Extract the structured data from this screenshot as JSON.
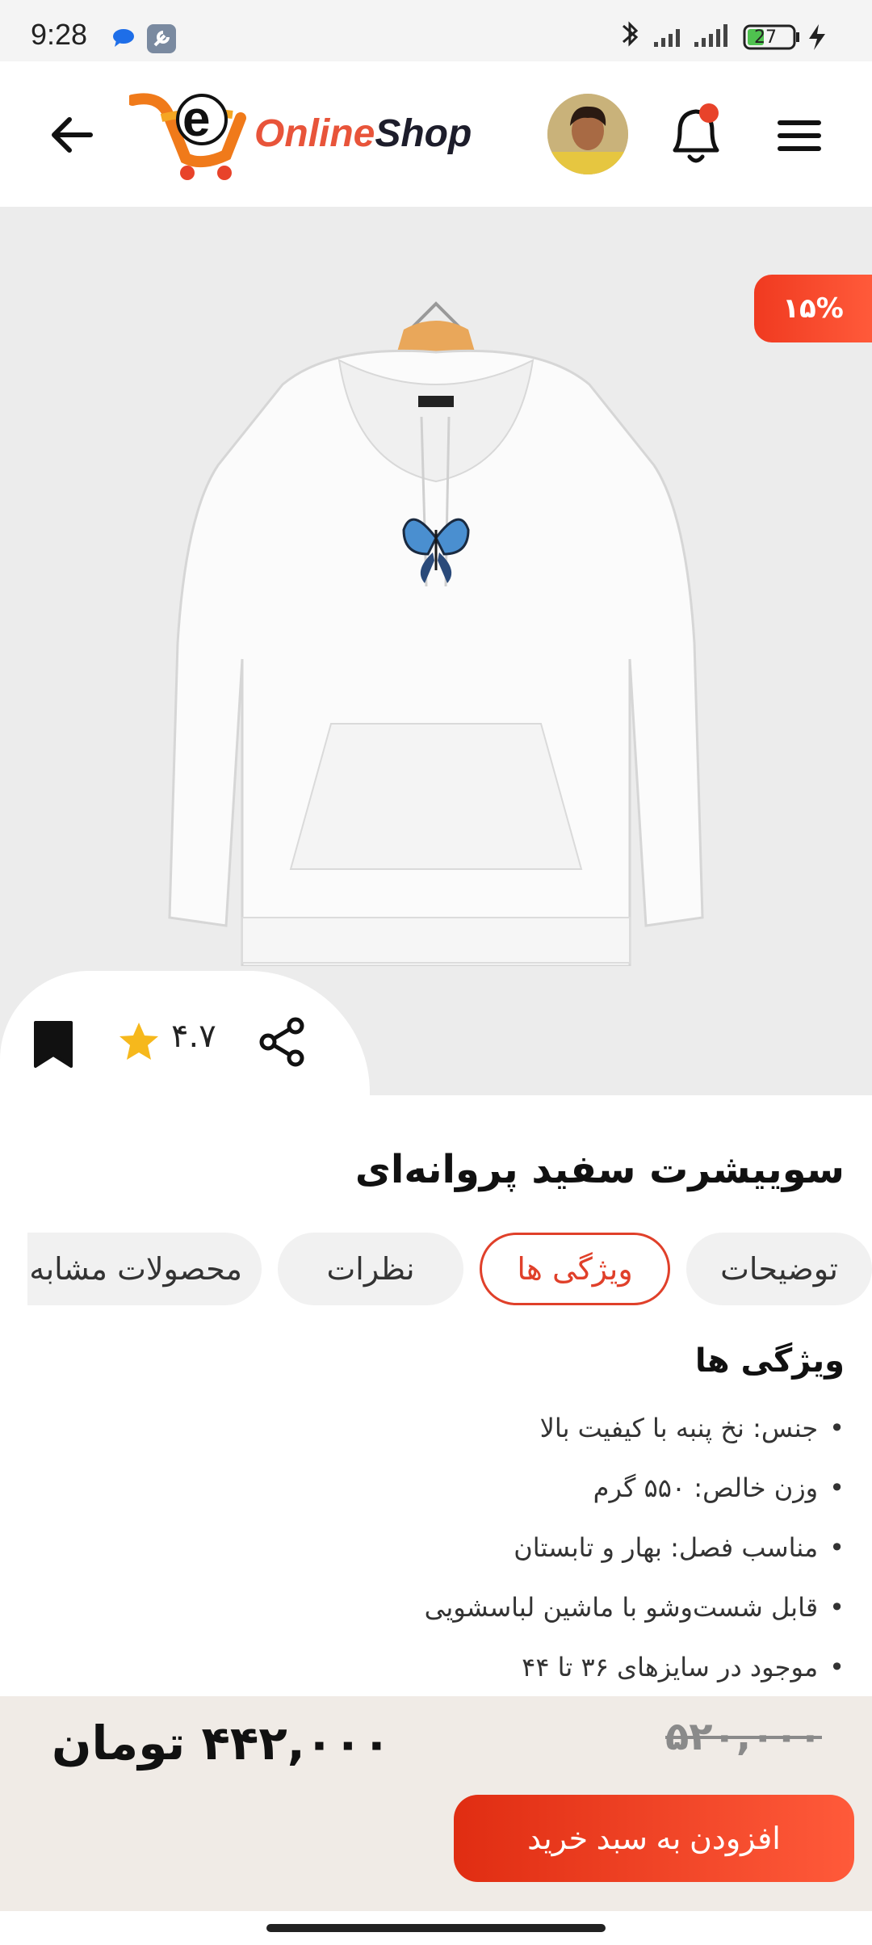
{
  "status_bar": {
    "time": "9:28",
    "battery": "27"
  },
  "header": {
    "logo_text_part1": "Online",
    "logo_text_part2": "Shop",
    "logo_letter": "e"
  },
  "product": {
    "discount_badge": "۱۵%",
    "rating": "۴.۷",
    "title": "سوییشرت سفید پروانه‌ای"
  },
  "tabs": [
    {
      "label": "توضیحات"
    },
    {
      "label": "ویژگی ها"
    },
    {
      "label": "نظرات"
    },
    {
      "label": "محصولات مشابه"
    }
  ],
  "features": {
    "heading": "ویژگی ها",
    "items": [
      "جنس: نخ پنبه با کیفیت بالا",
      "وزن خالص: ۵۵۰ گرم",
      "مناسب فصل: بهار و تابستان",
      "قابل شست‌وشو با ماشین لباسشویی",
      "موجود در سایزهای ۳۶ تا ۴۴"
    ]
  },
  "pricing": {
    "old_price": "۵۲۰,۰۰۰",
    "new_price": "۴۴۲,۰۰۰ تومان",
    "add_to_cart": "افزودن به سبد خرید"
  },
  "colors": {
    "accent": "#e8432a",
    "background_hero": "#ececec",
    "bottom_bar": "#f0ebe6"
  }
}
